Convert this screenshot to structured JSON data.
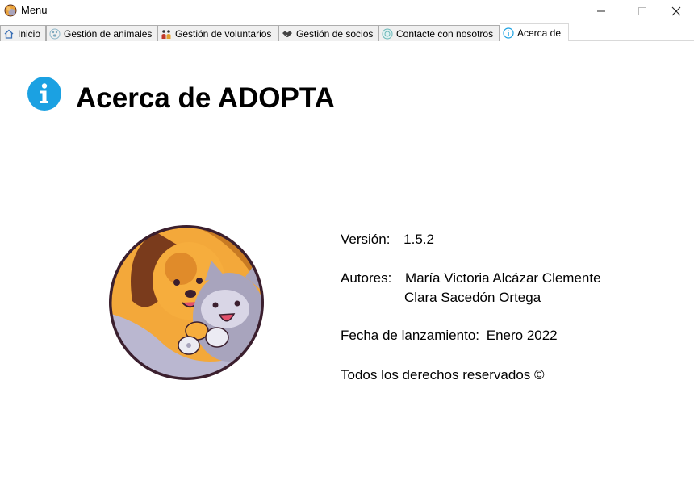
{
  "window": {
    "title": "Menu"
  },
  "tabs": [
    {
      "label": "Inicio",
      "icon": "home-icon"
    },
    {
      "label": "Gestión de animales",
      "icon": "paw-icon"
    },
    {
      "label": "Gestión de voluntarios",
      "icon": "volunteers-icon"
    },
    {
      "label": "Gestión de socios",
      "icon": "handshake-icon"
    },
    {
      "label": "Contacte con nosotros",
      "icon": "contact-icon"
    },
    {
      "label": "Acerca de",
      "icon": "info-icon",
      "active": true
    }
  ],
  "page": {
    "title": "Acerca de ADOPTA"
  },
  "about": {
    "version_label": "Versión:",
    "version_value": "1.5.2",
    "authors_label": "Autores:",
    "author1": "María Victoria Alcázar Clemente",
    "author2": "Clara Sacedón Ortega",
    "release_label": "Fecha de lanzamiento:",
    "release_value": "Enero 2022",
    "rights": "Todos los derechos reservados ©"
  },
  "colors": {
    "info_blue": "#1ba1e2",
    "logo_orange": "#f0a030",
    "logo_brown": "#7a3b1c",
    "logo_grey": "#a8a4bd"
  }
}
